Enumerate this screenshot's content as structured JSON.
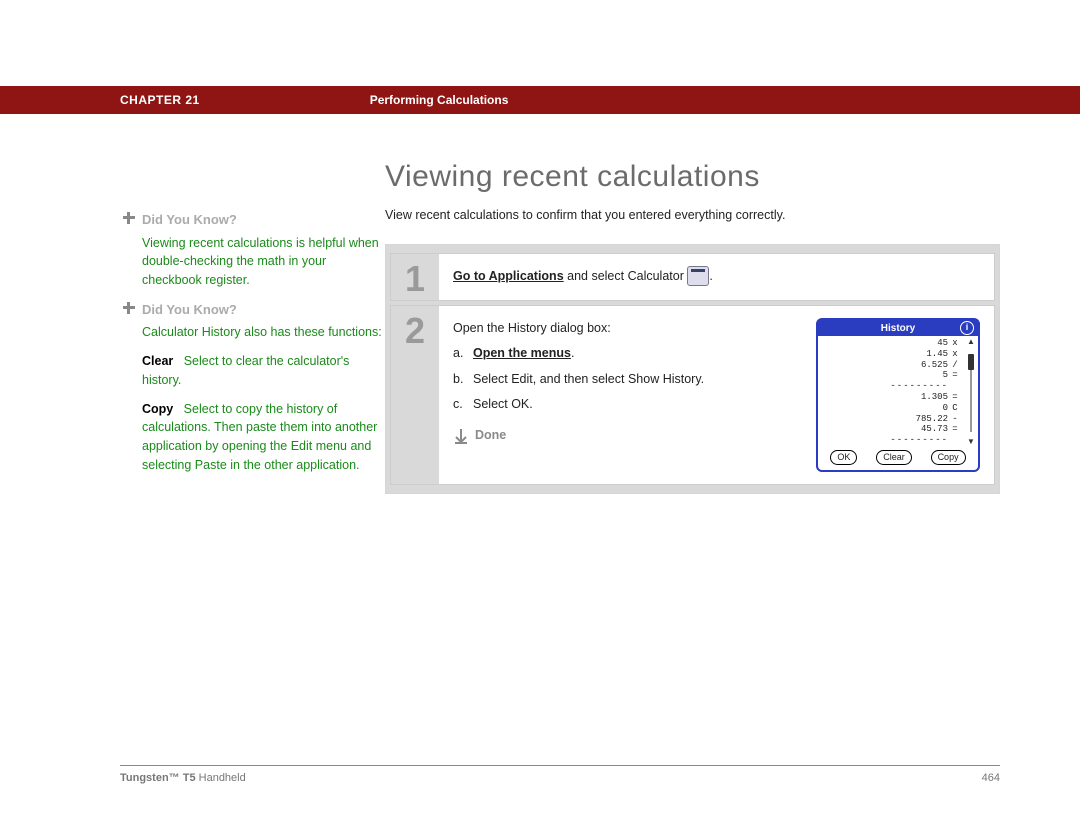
{
  "banner": {
    "chapter": "CHAPTER 21",
    "section": "Performing Calculations"
  },
  "heading": "Viewing recent calculations",
  "intro": "View recent calculations to confirm that you entered everything correctly.",
  "sidebar": {
    "dyk_label": "Did You Know?",
    "box1": "Viewing recent calculations is helpful when double-checking the math in your checkbook register.",
    "box2_intro": "Calculator History also has these functions:",
    "clear_label": "Clear",
    "clear_text": "Select to clear the calculator's history.",
    "copy_label": "Copy",
    "copy_text": "Select to copy the history of calculations. Then paste them into another application by opening the Edit menu and selecting Paste in the other application."
  },
  "steps": {
    "s1_link": "Go to Applications",
    "s1_rest": " and select Calculator ",
    "s1_period": ".",
    "s2_intro": "Open the History dialog box:",
    "s2a_let": "a.",
    "s2a_link": "Open the menus",
    "s2a_period": ".",
    "s2b_let": "b.",
    "s2b_text": "Select Edit, and then select Show History.",
    "s2c_let": "c.",
    "s2c_text": "Select OK.",
    "done": "Done"
  },
  "history": {
    "title": "History",
    "rows": [
      {
        "v": "45",
        "o": "x"
      },
      {
        "v": "1.45",
        "o": "x"
      },
      {
        "v": "6.525",
        "o": "/"
      },
      {
        "v": "5",
        "o": "="
      },
      {
        "v": "---------",
        "o": ""
      },
      {
        "v": "1.305",
        "o": "="
      },
      {
        "v": "0",
        "o": "C"
      },
      {
        "v": "785.22",
        "o": "-"
      },
      {
        "v": "45.73",
        "o": "="
      },
      {
        "v": "---------",
        "o": ""
      }
    ],
    "ok": "OK",
    "clear": "Clear",
    "copy": "Copy"
  },
  "footer": {
    "product_bold": "Tungsten™ T5",
    "product_light": " Handheld",
    "page": "464"
  }
}
